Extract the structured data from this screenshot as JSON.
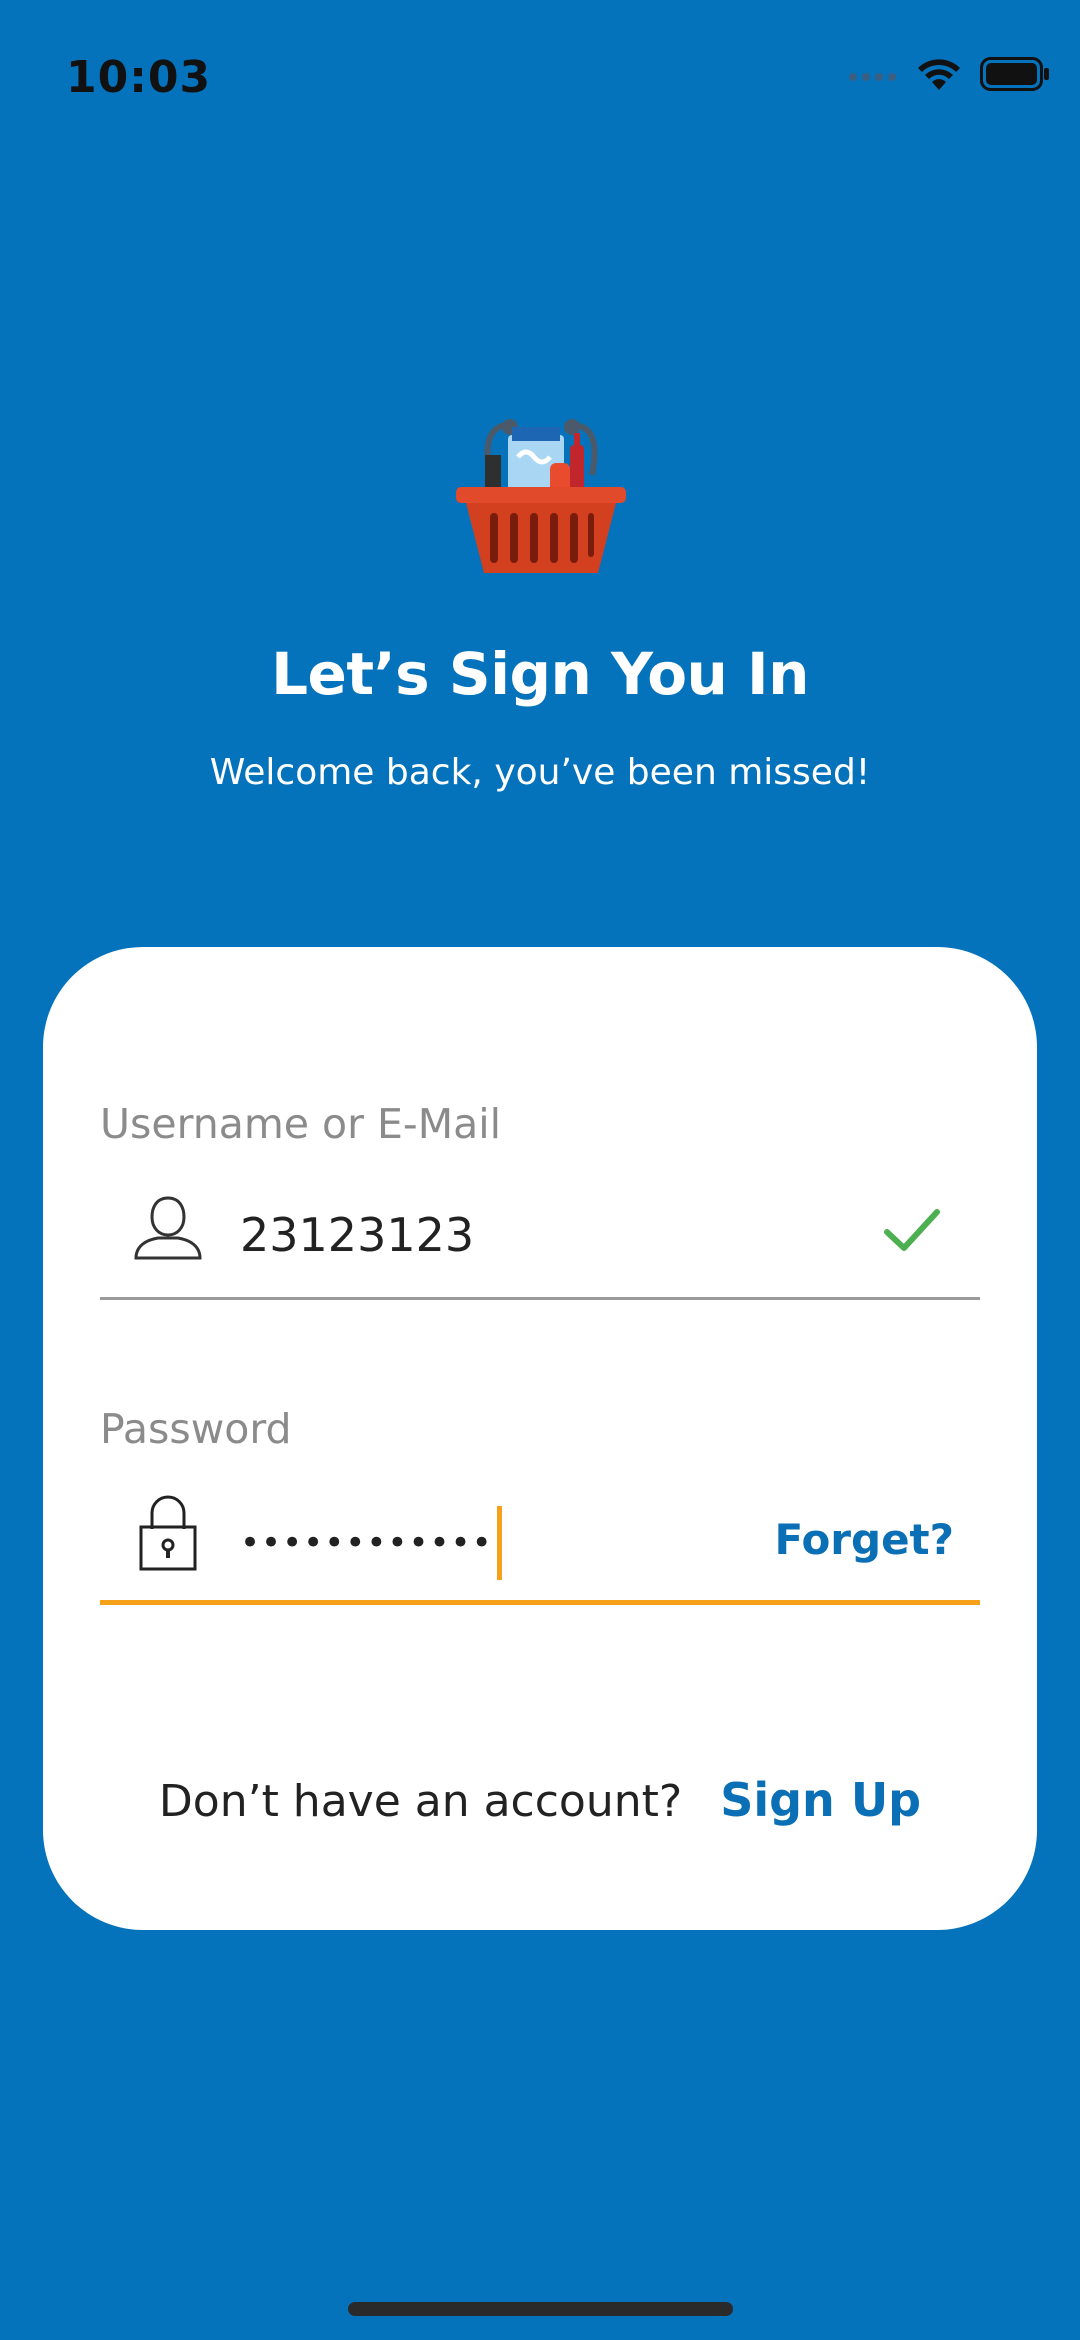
{
  "status_bar": {
    "time": "10:03",
    "icons": [
      "cellular-signal-icon",
      "wifi-icon",
      "battery-icon"
    ]
  },
  "header": {
    "logo_icon": "shopping-basket-icon",
    "title": "Let’s Sign You In",
    "subtitle": "Welcome back, you’ve been missed!"
  },
  "form": {
    "username": {
      "label": "Username or E-Mail",
      "value": "23123123",
      "icon": "user-icon",
      "status_icon": "checkmark-icon"
    },
    "password": {
      "label": "Password",
      "masked_value": "••••••••••••",
      "icon": "lock-icon",
      "forgot_label": "Forget?"
    }
  },
  "footer": {
    "prompt": "Don’t have an account?",
    "signup_label": "Sign Up"
  },
  "colors": {
    "background": "#0572bc",
    "card": "#ffffff",
    "accent_link": "#0a6fb5",
    "focus_underline": "#f5a11c",
    "success": "#4caf50"
  }
}
